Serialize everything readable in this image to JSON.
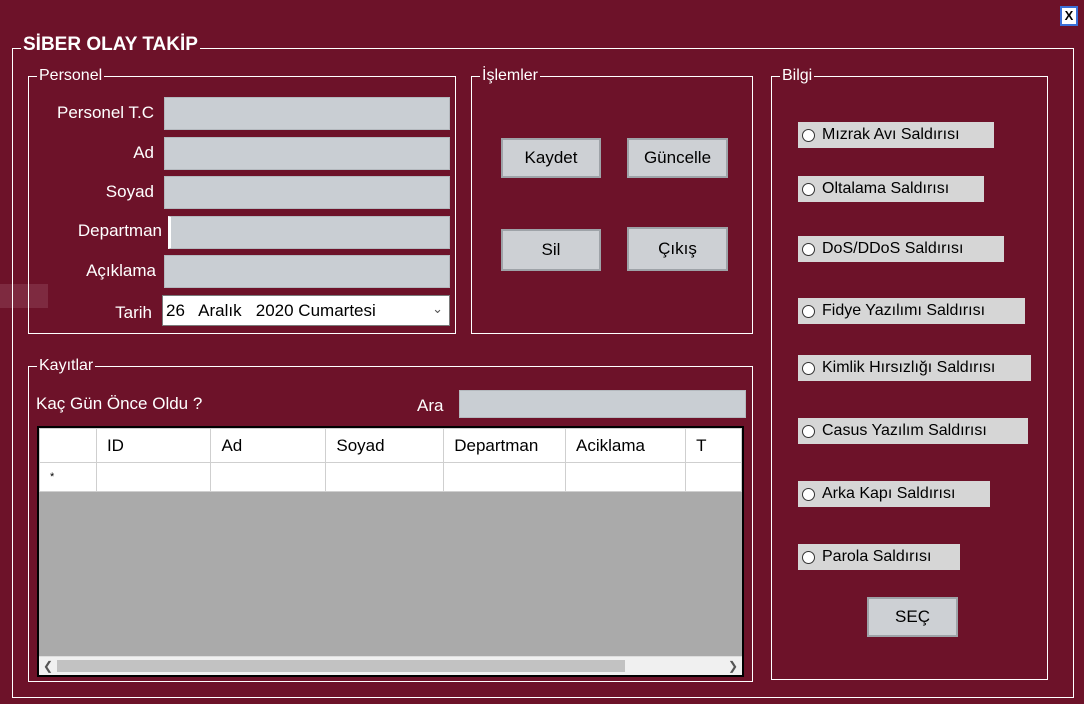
{
  "window": {
    "close_label": "X"
  },
  "main": {
    "title": "SİBER OLAY TAKİP"
  },
  "personel": {
    "legend": "Personel",
    "tc_label": "Personel T.C",
    "ad_label": "Ad",
    "soyad_label": "Soyad",
    "departman_label": "Departman",
    "aciklama_label": "Açıklama",
    "tarih_label": "Tarih",
    "tarih_value": "26   Aralık   2020 Cumartesi"
  },
  "islemler": {
    "legend": "İşlemler",
    "kaydet": "Kaydet",
    "guncelle": "Güncelle",
    "sil": "Sil",
    "cikis": "Çıkış"
  },
  "bilgi": {
    "legend": "Bilgi",
    "options": [
      "Mızrak Avı Saldırısı",
      "Oltalama Saldırısı",
      "DoS/DDoS Saldırısı",
      "Fidye Yazılımı Saldırısı",
      "Kimlik Hırsızlığı Saldırısı",
      "Casus Yazılım Saldırısı",
      "Arka Kapı Saldırısı",
      "Parola Saldırısı"
    ],
    "sec": "SEÇ"
  },
  "kayitlar": {
    "legend": "Kayıtlar",
    "kac_gun": "Kaç Gün Önce Oldu ?",
    "ara_label": "Ara",
    "columns": [
      "",
      "ID",
      "Ad",
      "Soyad",
      "Departman",
      "Aciklama",
      "T"
    ],
    "new_row_marker": "*"
  },
  "colors": {
    "background": "#6d1229",
    "control": "#c9ced3"
  }
}
